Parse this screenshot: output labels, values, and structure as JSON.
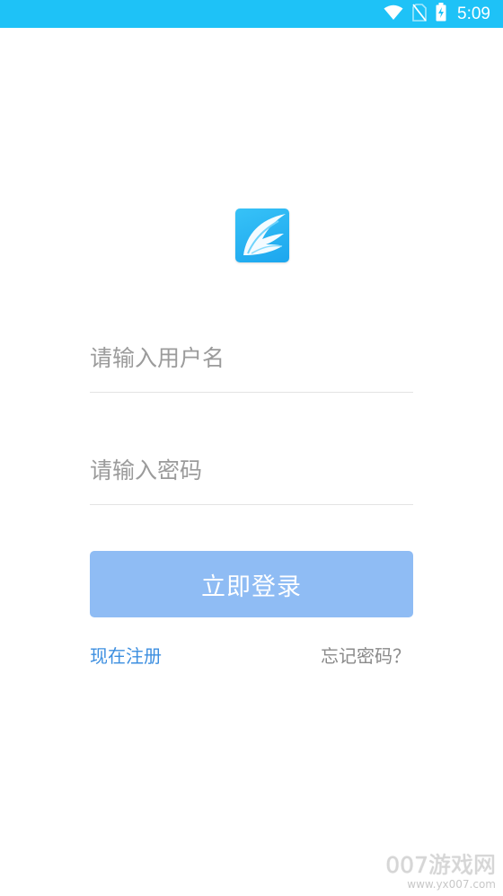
{
  "status_bar": {
    "time": "5:09",
    "icons": [
      "wifi-icon",
      "no-sim-icon",
      "battery-charging-icon"
    ],
    "background_color": "#1ec2f7"
  },
  "logo": {
    "icon": "wing-logo-icon",
    "color": "#1fb3f3"
  },
  "login_form": {
    "username_placeholder": "请输入用户名",
    "password_placeholder": "请输入密码",
    "submit_label": "立即登录",
    "submit_color": "#8fbcf4"
  },
  "links": {
    "register": "现在注册",
    "forgot_password": "忘记密码？",
    "register_color": "#3d8fe0"
  },
  "watermark": {
    "main": "007游戏网",
    "url": "www.yx007.com"
  }
}
